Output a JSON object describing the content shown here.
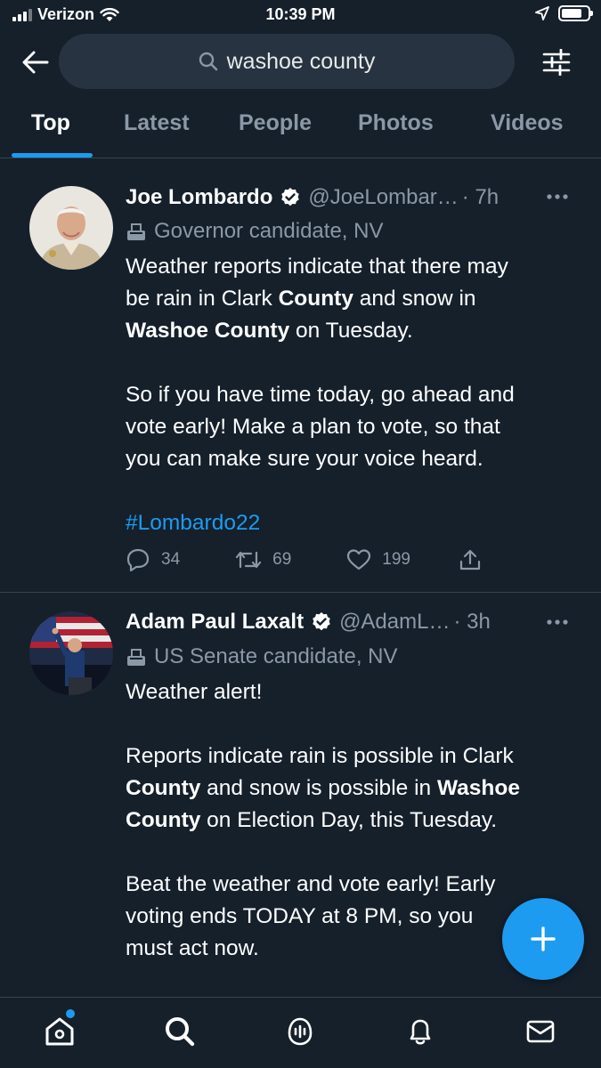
{
  "status_bar": {
    "carrier": "Verizon",
    "time": "10:39 PM",
    "battery_level": 0.78
  },
  "search": {
    "query": "washoe county",
    "icons": [
      "back-arrow-icon",
      "search-icon",
      "filter-icon"
    ]
  },
  "tabs": [
    {
      "label": "Top",
      "active": true
    },
    {
      "label": "Latest",
      "active": false
    },
    {
      "label": "People",
      "active": false
    },
    {
      "label": "Photos",
      "active": false
    },
    {
      "label": "Videos",
      "active": false
    }
  ],
  "tweets": [
    {
      "name": "Joe Lombardo",
      "verified": true,
      "handle": "@JoeLombar…",
      "time": "· 7h",
      "label": "Governor candidate, NV",
      "body_line1_a": "Weather reports indicate that there may",
      "body_line2_a": "be rain in Clark ",
      "body_line2_b": "County",
      "body_line2_c": " and snow in",
      "body_line3_a": "Washoe County",
      "body_line3_b": " on Tuesday.",
      "body_line4": "So if you have time today, go ahead and",
      "body_line5": "vote early! Make a plan to vote, so that",
      "body_line6": "you can make sure your voice heard.",
      "hashtag": "#Lombardo22",
      "replies": "34",
      "retweets": "69",
      "likes": "199"
    },
    {
      "name": "Adam Paul Laxalt",
      "verified": true,
      "handle": "@AdamL…",
      "time": "· 3h",
      "label": "US Senate candidate, NV",
      "body_line1": "Weather alert!",
      "body_line2": "Reports indicate rain is possible in Clark",
      "body_line3_a": "County",
      "body_line3_b": " and snow is possible in ",
      "body_line3_c": "Washoe",
      "body_line4_a": "County",
      "body_line4_b": " on Election Day, this Tuesday.",
      "body_line5": "Beat the weather and vote early! Early",
      "body_line6": "voting ends TODAY at 8 PM, so you",
      "body_line7": "must act now."
    }
  ],
  "bottom_nav": [
    "home-icon",
    "search-icon",
    "spaces-icon",
    "notifications-icon",
    "messages-icon"
  ],
  "colors": {
    "background": "#15202b",
    "accent": "#1d9bf0",
    "secondary_text": "#8b98a5",
    "divider": "#38444d"
  }
}
